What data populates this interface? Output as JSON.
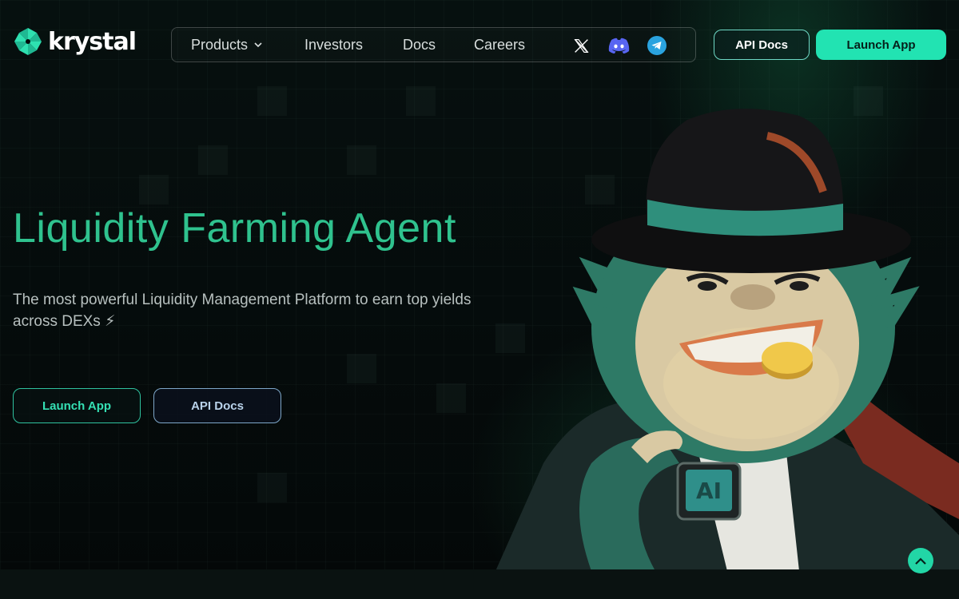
{
  "brand": {
    "name": "krystal"
  },
  "nav": {
    "products": "Products",
    "investors": "Investors",
    "docs": "Docs",
    "careers": "Careers",
    "icons": [
      "x-twitter-icon",
      "discord-icon",
      "telegram-icon"
    ]
  },
  "header_buttons": {
    "api_docs": "API Docs",
    "launch_app": "Launch App"
  },
  "hero": {
    "title": "Liquidity Farming Agent",
    "subtitle": "The most powerful Liquidity Management Platform to earn top yields across DEXs ⚡",
    "launch_app": "Launch App",
    "api_docs": "API Docs"
  },
  "mascot": {
    "chip_label": "AI"
  },
  "colors": {
    "accent": "#22e3b2",
    "title": "#2fc28e",
    "background": "#05090a",
    "discord": "#5865f2",
    "telegram": "#2aa3df"
  }
}
